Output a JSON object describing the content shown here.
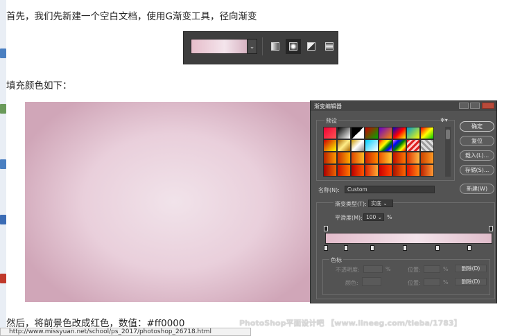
{
  "article": {
    "line1": "首先，我们先新建一个空白文档，使用G渐变工具，径向渐变",
    "line2": "填充颜色如下：",
    "line3": "然后，将前景色改成红色，数值：#ff0000"
  },
  "toolbar": {
    "dropdown_glyph": "⌄",
    "gradient_types": [
      "linear",
      "radial",
      "angle",
      "reflected"
    ],
    "selected_type": "radial"
  },
  "dialog": {
    "title": "渐变编辑器",
    "presets_label": "预设",
    "ok": "确定",
    "reset": "复位",
    "load": "载入(L)...",
    "save": "存储(S)...",
    "name_label": "名称(N):",
    "name_value": "Custom",
    "new_button": "新建(W)",
    "type_label": "渐变类型(T):",
    "type_value": "实底",
    "smooth_label": "平滑度(M):",
    "smooth_value": "100",
    "smooth_unit": "%",
    "stops_group": "色标",
    "opacity_label": "不透明度:",
    "percent": "%",
    "location_label": "位置:",
    "delete_label": "删除(D)",
    "color_label": "颜色:",
    "colors": {
      "accent": "#e3bccb",
      "mid": "#f3e3ea",
      "bg": "#535353"
    }
  },
  "watermark": "PhotoShop平面设计吧 【www.lineeg.com/tieba/1783】",
  "status_bar": "http://www.missyuan.net/school/ps_2017/photoshop_26718.html"
}
